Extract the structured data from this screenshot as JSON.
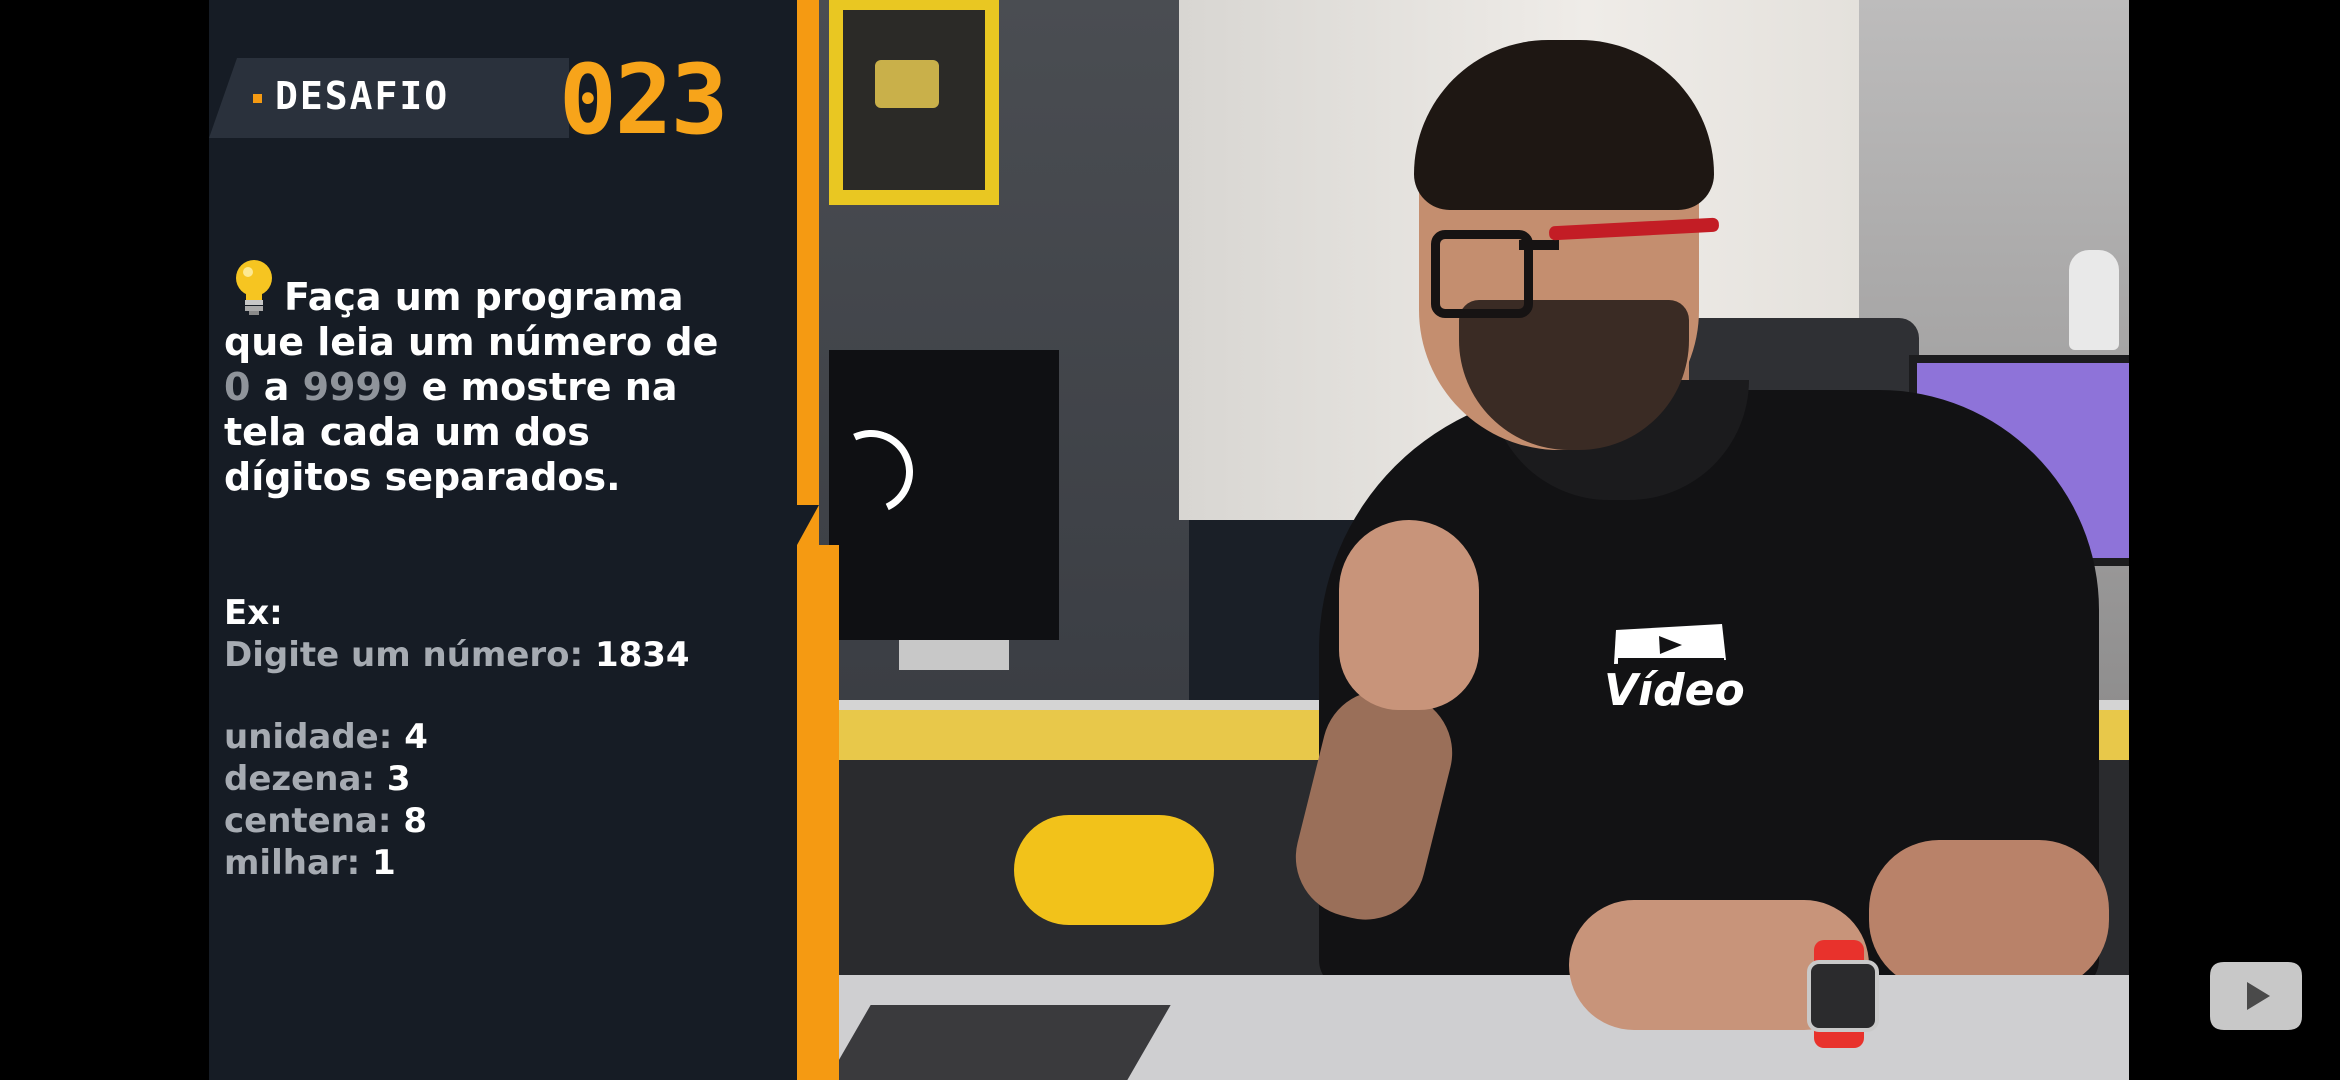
{
  "panel": {
    "header_label": "DESAFIO",
    "challenge_number": "023",
    "statement_lines": [
      "Faça um programa",
      "que leia um número de",
      "e mostre na",
      "tela cada um dos",
      "dígitos separados."
    ],
    "range_from": "0",
    "range_connector": "a",
    "range_to": "9999",
    "example_title": "Ex:",
    "example_prompt_label": "Digite um número:",
    "example_prompt_value": "1834",
    "results": [
      {
        "label": "unidade:",
        "value": "4"
      },
      {
        "label": "dezena:",
        "value": "3"
      },
      {
        "label": "centena:",
        "value": "8"
      },
      {
        "label": "milhar:",
        "value": "1"
      }
    ]
  },
  "video": {
    "shirt_brand": "Vídeo"
  },
  "controls": {
    "play_button_icon": "play-icon"
  },
  "colors": {
    "accent": "#f59a12",
    "panel_bg": "#161c25",
    "number": "#f7a41a"
  }
}
